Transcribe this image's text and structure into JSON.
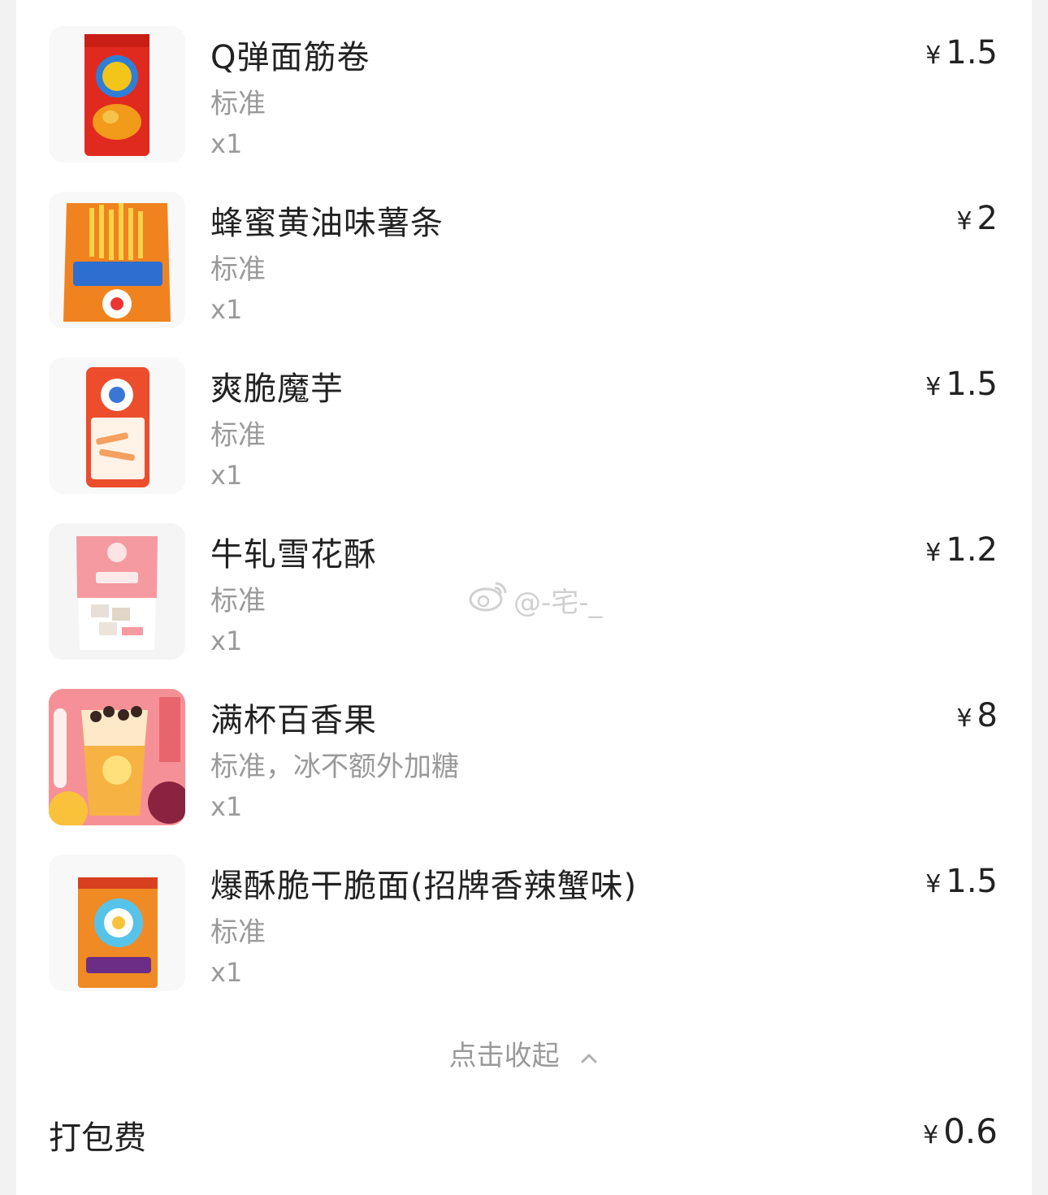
{
  "items": [
    {
      "name": "Q弹面筋卷",
      "spec": "标准",
      "qty": "x1",
      "price": "1.5",
      "currency": "¥",
      "image_icon": "red-snack-bag-icon"
    },
    {
      "name": "蜂蜜黄油味薯条",
      "spec": "标准",
      "qty": "x1",
      "price": "2",
      "currency": "¥",
      "image_icon": "fries-bag-icon"
    },
    {
      "name": "爽脆魔芋",
      "spec": "标准",
      "qty": "x1",
      "price": "1.5",
      "currency": "¥",
      "image_icon": "konjac-bag-icon"
    },
    {
      "name": "牛轧雪花酥",
      "spec": "标准",
      "qty": "x1",
      "price": "1.2",
      "currency": "¥",
      "image_icon": "nougat-bag-icon"
    },
    {
      "name": "满杯百香果",
      "spec": "标准，冰不额外加糖",
      "qty": "x1",
      "price": "8",
      "currency": "¥",
      "image_icon": "passionfruit-tea-icon"
    },
    {
      "name": "爆酥脆干脆面(招牌香辣蟹味)",
      "spec": "标准",
      "qty": "x1",
      "price": "1.5",
      "currency": "¥",
      "image_icon": "crispy-noodle-bag-icon"
    }
  ],
  "collapse_label": "点击收起",
  "packing_fee": {
    "label": "打包费",
    "currency": "¥",
    "price": "0.6"
  },
  "watermark": {
    "text": "@-宅-_",
    "icon": "weibo-icon"
  },
  "colors": {
    "background": "#f2f2f2",
    "card": "#ffffff",
    "text": "#222222",
    "muted": "#9a9a9a"
  }
}
